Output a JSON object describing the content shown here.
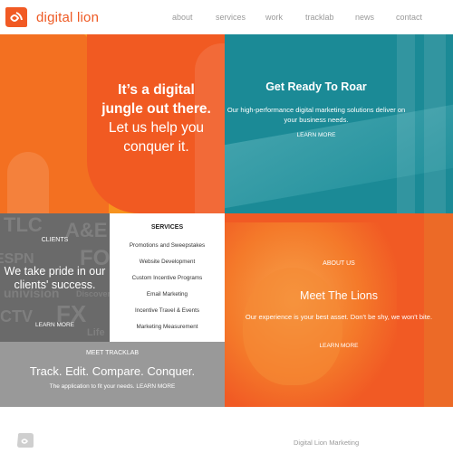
{
  "header": {
    "brand": "digital lion",
    "nav": [
      "about",
      "services",
      "work",
      "tracklab",
      "news",
      "contact"
    ]
  },
  "hero": {
    "line1": "It’s a digital",
    "line2": "jungle out there.",
    "line3": "Let us help you",
    "line4": "conquer it."
  },
  "roar": {
    "title": "Get Ready To Roar",
    "description": "Our high-performance digital marketing solutions deliver on your business needs.",
    "learn_more": "LEARN MORE"
  },
  "clients": {
    "label": "CLIENTS",
    "text": "We take pride in our clients' success.",
    "learn_more": "LEARN MORE",
    "logos": [
      "TLC",
      "A&E",
      "ESPN",
      "FOX",
      "univision",
      "CTV",
      "FX",
      "Discovery",
      "Life"
    ]
  },
  "services": {
    "heading": "SERVICES",
    "items": [
      "Promotions and Sweepstakes",
      "Website Development",
      "Custom Incentive Programs",
      "Email Marketing",
      "Incentive Travel & Events",
      "Marketing Measurement"
    ]
  },
  "tracklab": {
    "label": "MEET TRACKLAB",
    "title": "Track. Edit. Compare. Conquer.",
    "description": "The application to fit your needs.",
    "learn_more": "LEARN MORE"
  },
  "lions": {
    "label": "ABOUT US",
    "title": "Meet The Lions",
    "description": "Our experience is your best asset. Don't be shy, we won't bite.",
    "learn_more": "LEARN MORE"
  },
  "footer": {
    "text": "Digital Lion Marketing"
  },
  "colors": {
    "brand_orange": "#f15a24",
    "hero_orange": "#f7931e",
    "teal": "#1b8a96",
    "client_gray": "#6a6a6a",
    "tracklab_gray": "#999999"
  }
}
